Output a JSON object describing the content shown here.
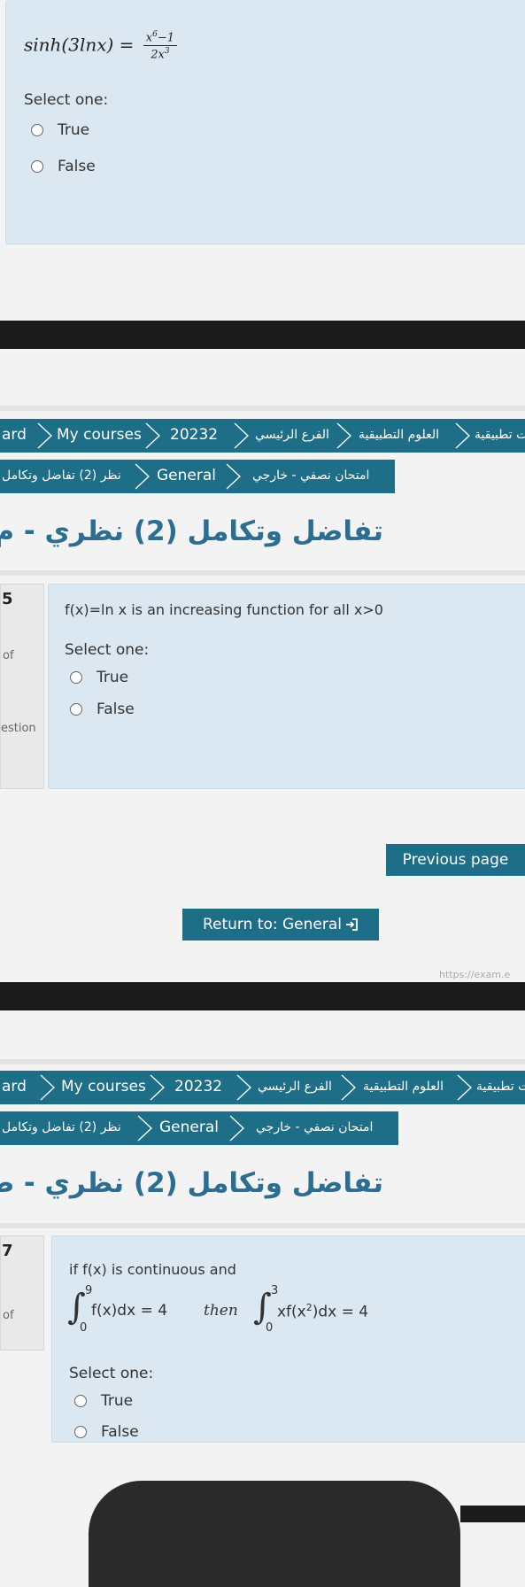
{
  "section1": {
    "formula_lhs": "sinh(3lnx) =",
    "frac_num_base": "x",
    "frac_num_exp": "6",
    "frac_num_rest": "−1",
    "frac_den_base": "2x",
    "frac_den_exp": "3",
    "select_one": "Select one:",
    "options": [
      "True",
      "False"
    ]
  },
  "section2": {
    "breadcrumb_row1": [
      "ard",
      "My courses",
      "20232",
      "الفرع الرئيسي",
      "العلوم التطبيقية",
      "كات تطبيقية"
    ],
    "breadcrumb_row2": [
      "نظر (2) تفاضل وتكامل",
      "General",
      "امتحان نصفي - خارجي"
    ],
    "heading": "تفاضل وتكامل (2) نظري - م",
    "info_number": "5",
    "info_of": "of",
    "info_question": "estion",
    "question": "f(x)=ln x is an increasing function for all x>0",
    "select_one": "Select one:",
    "options": [
      "True",
      "False"
    ],
    "previous_page": "Previous page",
    "return_to": "Return to: General",
    "url_fragment": "https://exam.e"
  },
  "section3": {
    "breadcrumb_row1": [
      "ard",
      "My courses",
      "20232",
      "الفرع الرئيسي",
      "العلوم التطبيقية",
      "كات تطبيقية"
    ],
    "breadcrumb_row2": [
      "نظر (2) تفاضل وتكامل",
      "General",
      "امتحان نصفي - خارجي"
    ],
    "heading": "تفاضل وتكامل (2) نظري - ط",
    "info_number": "7",
    "info_of": "of",
    "question_intro": "if f(x) is continuous and",
    "integral1_upper": "9",
    "integral1_lower": "0",
    "integral1_body": "f(x)dx = 4",
    "then_word": "then",
    "integral2_upper": "3",
    "integral2_lower": "0",
    "integral2_body_pre": "xf(x",
    "integral2_body_exp": "2",
    "integral2_body_post": ")dx  = 4",
    "select_one": "Select one:",
    "options": [
      "True",
      "False"
    ]
  },
  "colors": {
    "breadcrumb_bg": "#1d6e86",
    "question_bg": "#dbe8f2",
    "heading": "#2c6e91",
    "black_bar": "#1b1b1b"
  }
}
